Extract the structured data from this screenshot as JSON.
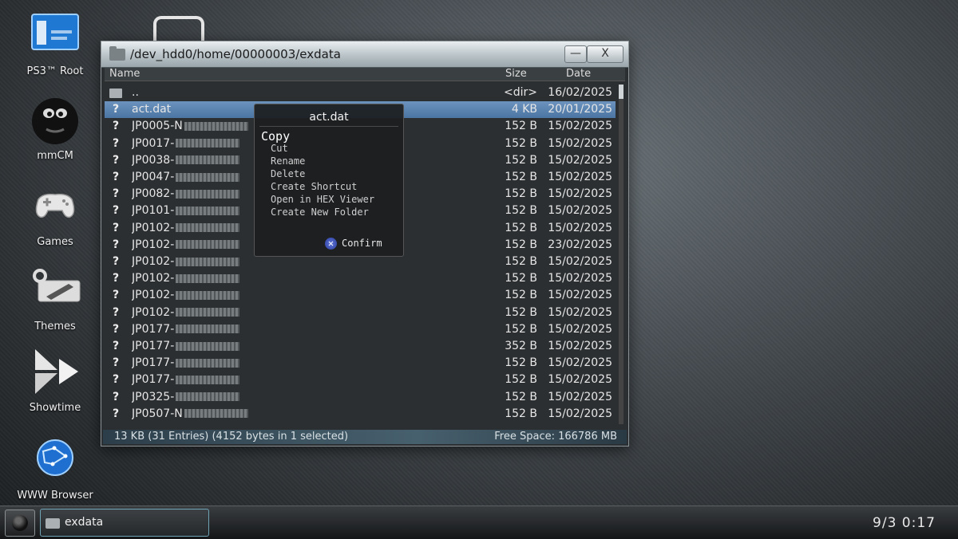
{
  "desktop": {
    "icons": [
      {
        "label": "PS3™ Root"
      },
      {
        "label": "mmCM"
      },
      {
        "label": "Games"
      },
      {
        "label": "Themes"
      },
      {
        "label": "Showtime"
      },
      {
        "label": "WWW Browser"
      }
    ]
  },
  "window": {
    "path": "/dev_hdd0/home/00000003/exdata",
    "min_label": "—",
    "close_label": "X",
    "columns": {
      "name": "Name",
      "size": "Size",
      "date": "Date"
    },
    "rows": [
      {
        "icon": "folder",
        "name": "..",
        "size": "<dir>",
        "date": "16/02/2025"
      },
      {
        "icon": "?",
        "name": "act.dat",
        "size": "4 KB",
        "date": "20/01/2025",
        "selected": true
      },
      {
        "icon": "?",
        "name": "JP0005-N",
        "size": "152 B",
        "date": "15/02/2025"
      },
      {
        "icon": "?",
        "name": "JP0017-",
        "size": "152 B",
        "date": "15/02/2025"
      },
      {
        "icon": "?",
        "name": "JP0038-",
        "size": "152 B",
        "date": "15/02/2025"
      },
      {
        "icon": "?",
        "name": "JP0047-",
        "size": "152 B",
        "date": "15/02/2025"
      },
      {
        "icon": "?",
        "name": "JP0082-",
        "size": "152 B",
        "date": "15/02/2025"
      },
      {
        "icon": "?",
        "name": "JP0101-",
        "size": "152 B",
        "date": "15/02/2025"
      },
      {
        "icon": "?",
        "name": "JP0102-",
        "size": "152 B",
        "date": "15/02/2025"
      },
      {
        "icon": "?",
        "name": "JP0102-",
        "size": "152 B",
        "date": "23/02/2025"
      },
      {
        "icon": "?",
        "name": "JP0102-",
        "size": "152 B",
        "date": "15/02/2025"
      },
      {
        "icon": "?",
        "name": "JP0102-",
        "size": "152 B",
        "date": "15/02/2025"
      },
      {
        "icon": "?",
        "name": "JP0102-",
        "size": "152 B",
        "date": "15/02/2025"
      },
      {
        "icon": "?",
        "name": "JP0102-",
        "size": "152 B",
        "date": "15/02/2025"
      },
      {
        "icon": "?",
        "name": "JP0177-",
        "size": "152 B",
        "date": "15/02/2025"
      },
      {
        "icon": "?",
        "name": "JP0177-",
        "size": "352 B",
        "date": "15/02/2025"
      },
      {
        "icon": "?",
        "name": "JP0177-",
        "size": "152 B",
        "date": "15/02/2025"
      },
      {
        "icon": "?",
        "name": "JP0177-",
        "size": "152 B",
        "date": "15/02/2025"
      },
      {
        "icon": "?",
        "name": "JP0325-",
        "size": "152 B",
        "date": "15/02/2025"
      },
      {
        "icon": "?",
        "name": "JP0507-N",
        "size": "152 B",
        "date": "15/02/2025"
      }
    ],
    "status_left": "13 KB (31 Entries) (4152 bytes in 1 selected)",
    "status_right": "Free Space: 166786 MB"
  },
  "context_menu": {
    "title": "act.dat",
    "items": [
      "Copy",
      "Cut",
      "Rename",
      "Delete",
      "Create Shortcut",
      "Open in HEX Viewer",
      "Create New Folder"
    ],
    "confirm_glyph": "✕",
    "confirm_label": "Confirm"
  },
  "taskbar": {
    "task_label": "exdata",
    "clock": "9/3  0:17"
  },
  "colors": {
    "selection": "#5b83b0",
    "accent": "#6fa3b6"
  }
}
